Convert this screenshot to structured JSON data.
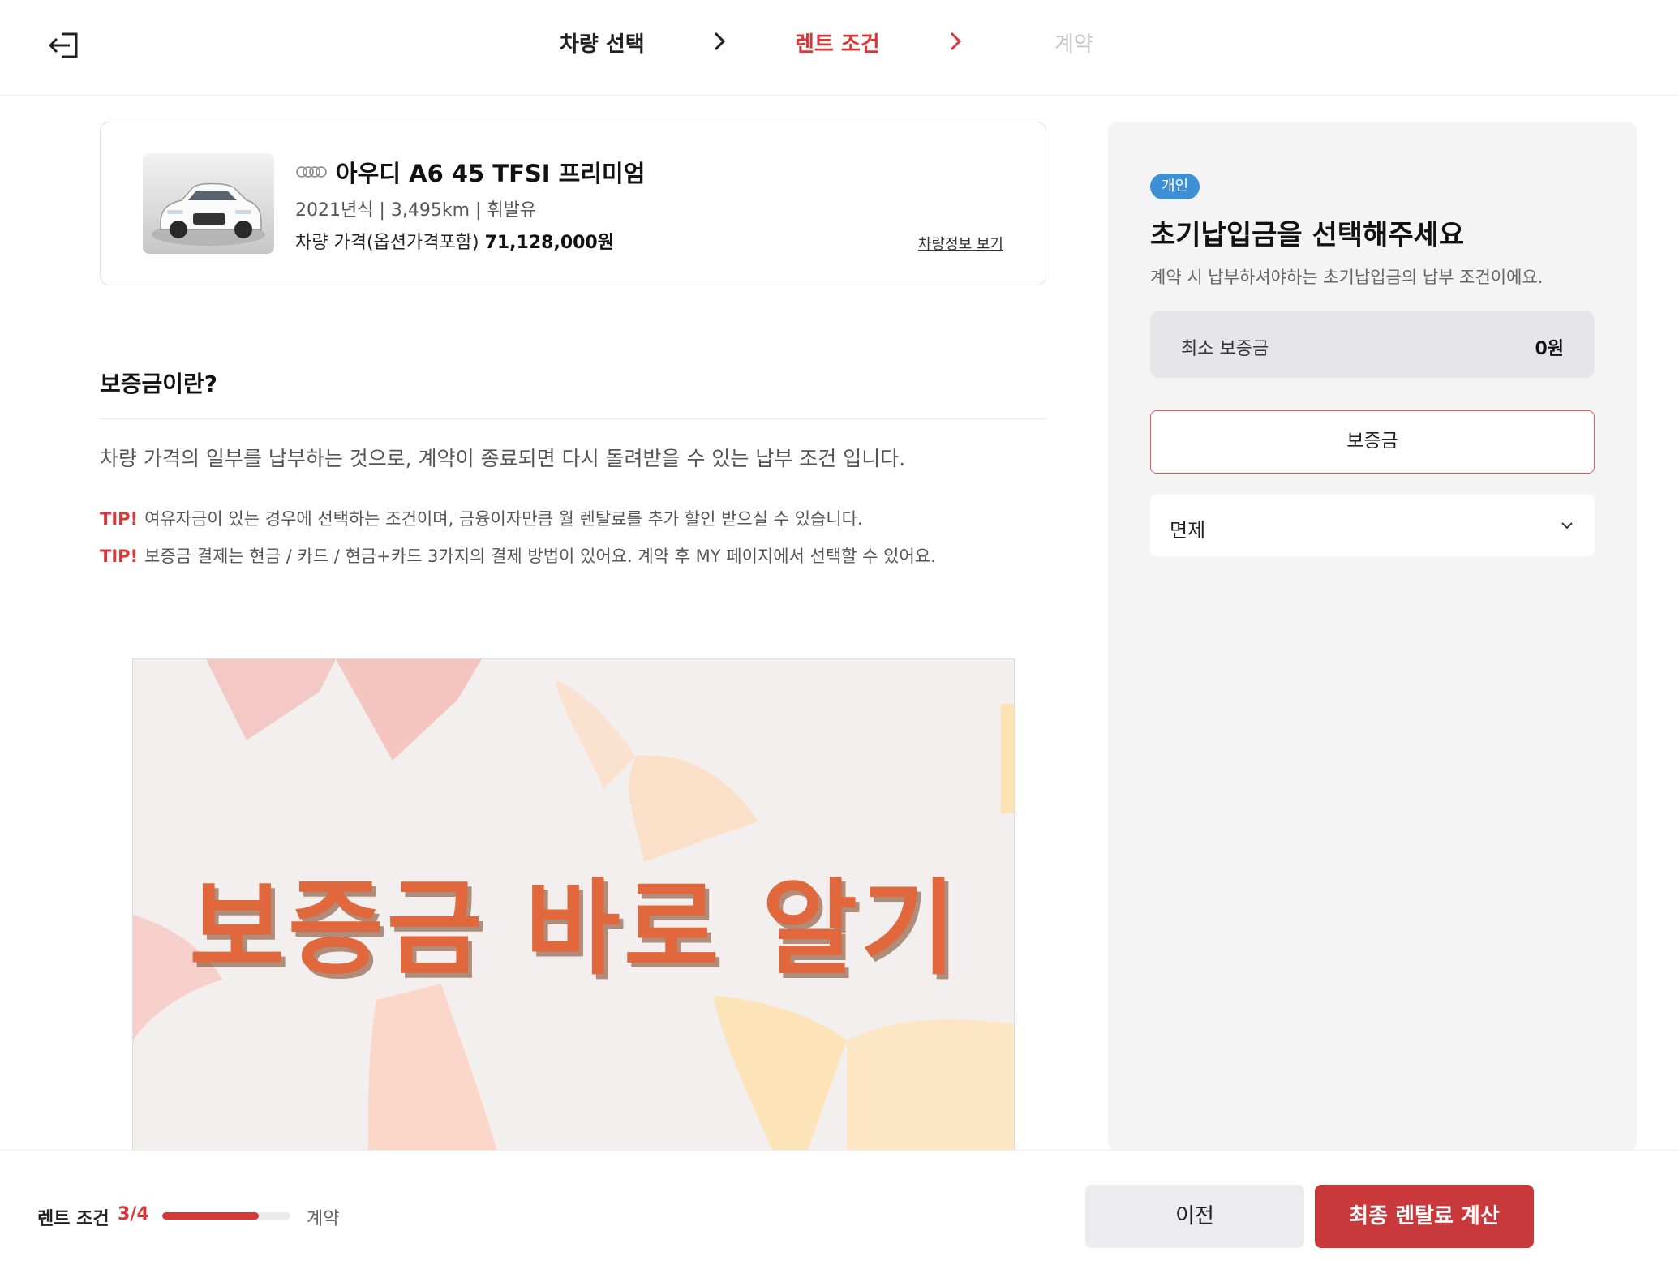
{
  "header": {
    "steps": [
      {
        "label": "차량 선택",
        "state": "done"
      },
      {
        "label": "렌트 조건",
        "state": "active"
      },
      {
        "label": "계약",
        "state": "pending"
      }
    ]
  },
  "car": {
    "name": "아우디 A6 45 TFSI 프리미엄",
    "meta": "2021년식 | 3,495km | 휘발유",
    "price_label": "차량 가격(옵션가격포함)",
    "price_value": "71,128,000원",
    "info_link": "차량정보 보기"
  },
  "deposit_info": {
    "title": "보증금이란?",
    "description": "차량 가격의 일부를 납부하는 것으로, 계약이 종료되면 다시 돌려받을 수 있는 납부 조건 입니다.",
    "tips": [
      {
        "label": "TIP!",
        "text": "여유자금이 있는 경우에 선택하는 조건이며, 금융이자만큼 월 렌탈료를 추가 할인 받으실 수 있습니다."
      },
      {
        "label": "TIP!",
        "text": "보증금 결제는 현금 / 카드 / 현금+카드 3가지의 결제 방법이 있어요. 계약 후 MY 페이지에서 선택할 수 있어요."
      }
    ],
    "banner_text": "보증금 바로 알기"
  },
  "panel": {
    "badge": "개인",
    "title": "초기납입금을 선택해주세요",
    "subtitle": "계약 시 납부하셔야하는 초기납입금의 납부 조건이에요.",
    "min_deposit_label": "최소 보증금",
    "min_deposit_value": "0원",
    "option_label": "보증금",
    "select_value": "면제"
  },
  "footer": {
    "current_step": "렌트 조건",
    "step_count": "3/4",
    "progress_fraction": 0.75,
    "next_step": "계약",
    "prev_button": "이전",
    "calc_button": "최종 렌탈료 계산"
  },
  "colors": {
    "accent": "#d8373a",
    "badge": "#3d8fd6",
    "panel_bg": "#f4f4f5"
  }
}
